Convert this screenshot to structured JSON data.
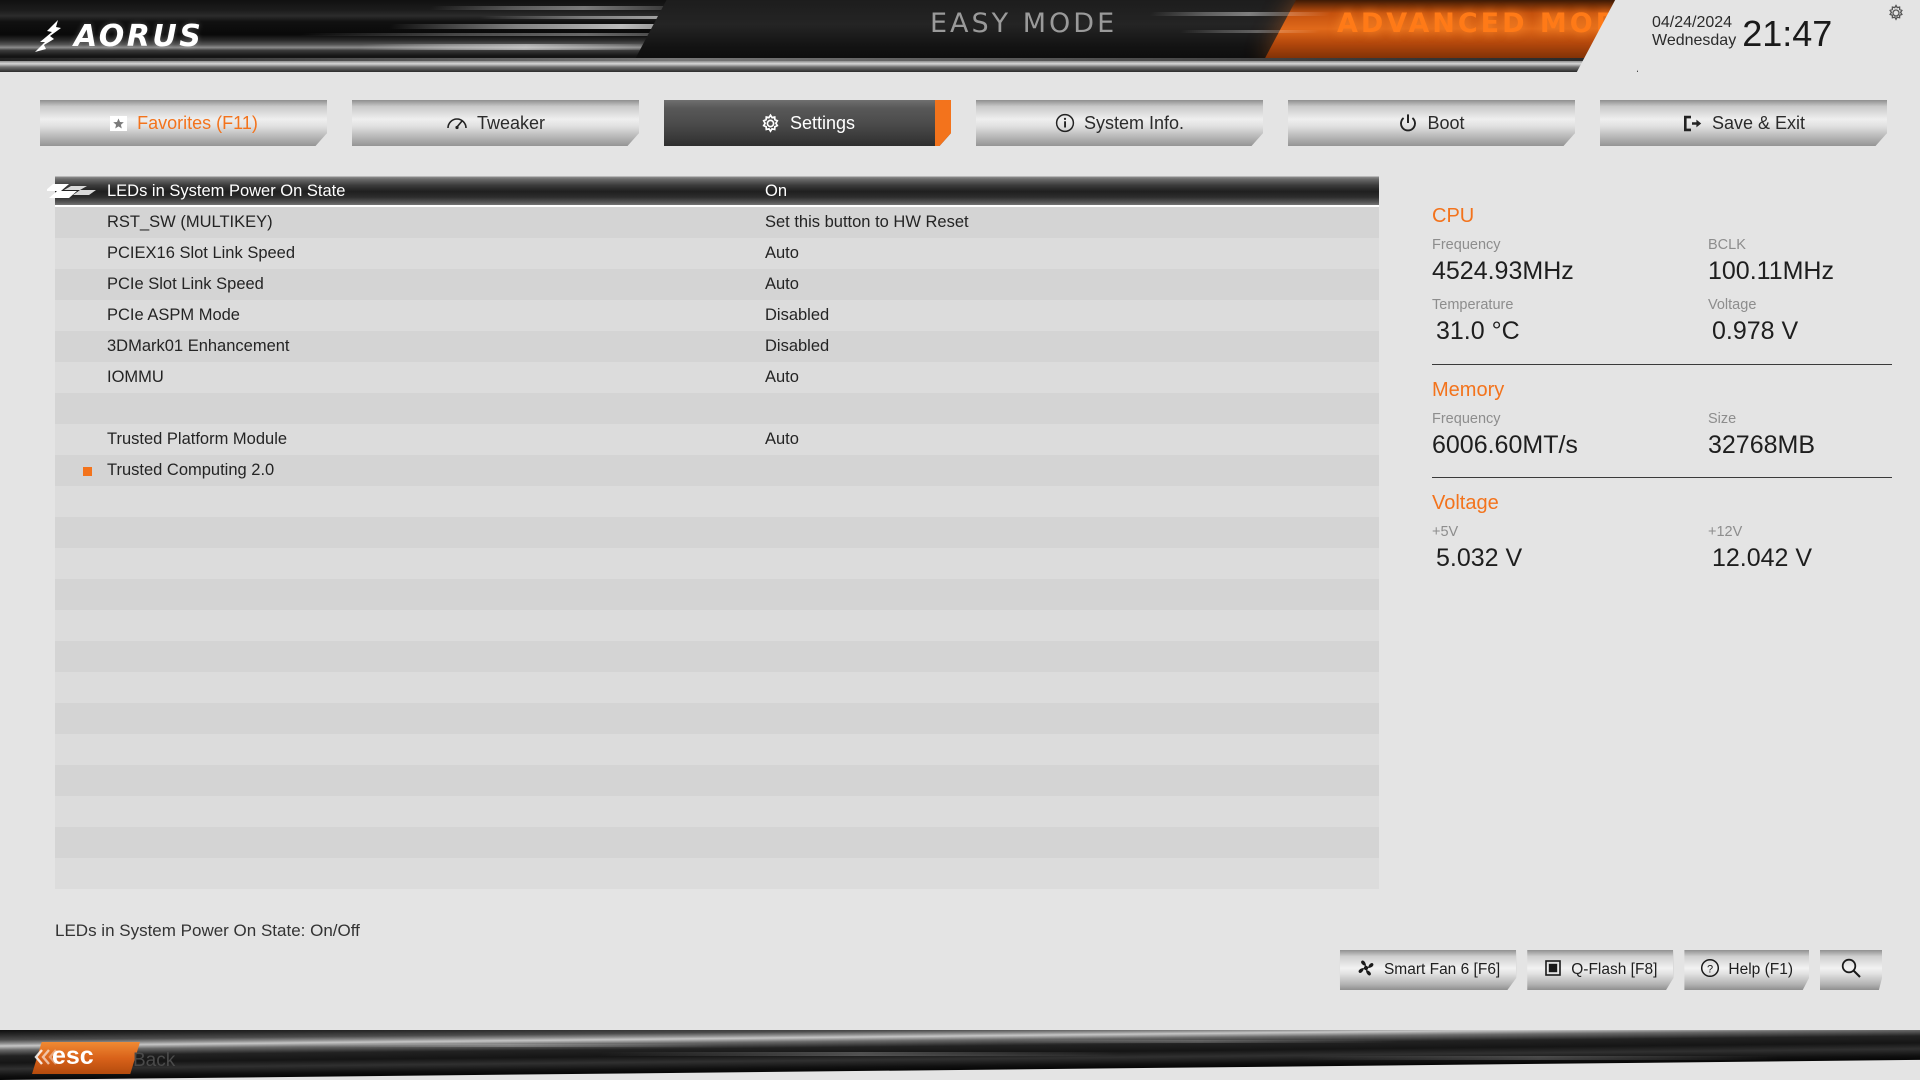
{
  "brand": {
    "logo_text": "AORUS",
    "logo_icon": "falcon-logo-icon"
  },
  "header": {
    "easy_mode": "EASY MODE",
    "advanced_mode": "ADVANCED MODE",
    "date": "04/24/2024",
    "weekday": "Wednesday",
    "time": "21:47",
    "gear_icon": "gear-icon",
    "accent_color": "#f3731c"
  },
  "tabs": [
    {
      "label": "Favorites (F11)",
      "icon": "star-icon",
      "active": false,
      "favorite": true
    },
    {
      "label": "Tweaker",
      "icon": "gauge-icon",
      "active": false,
      "favorite": false
    },
    {
      "label": "Settings",
      "icon": "gear-icon",
      "active": true,
      "favorite": false
    },
    {
      "label": "System Info.",
      "icon": "info-circle-icon",
      "active": false,
      "favorite": false
    },
    {
      "label": "Boot",
      "icon": "power-icon",
      "active": false,
      "favorite": false
    },
    {
      "label": "Save & Exit",
      "icon": "exit-door-icon",
      "active": false,
      "favorite": false
    }
  ],
  "settings_rows": [
    {
      "label": "LEDs in System Power On State",
      "value": "On",
      "selected": true,
      "bullet": false
    },
    {
      "label": "RST_SW (MULTIKEY)",
      "value": "Set this button to HW Reset",
      "selected": false,
      "bullet": false
    },
    {
      "label": "PCIEX16 Slot Link Speed",
      "value": "Auto",
      "selected": false,
      "bullet": false
    },
    {
      "label": "PCIe Slot Link Speed",
      "value": "Auto",
      "selected": false,
      "bullet": false
    },
    {
      "label": "PCIe ASPM Mode",
      "value": "Disabled",
      "selected": false,
      "bullet": false
    },
    {
      "label": "3DMark01 Enhancement",
      "value": "Disabled",
      "selected": false,
      "bullet": false
    },
    {
      "label": "IOMMU",
      "value": "Auto",
      "selected": false,
      "bullet": false
    },
    {
      "label": "",
      "value": "",
      "selected": false,
      "bullet": false
    },
    {
      "label": "Trusted Platform Module",
      "value": "Auto",
      "selected": false,
      "bullet": false
    },
    {
      "label": "Trusted Computing 2.0",
      "value": "",
      "selected": false,
      "bullet": true
    },
    {
      "label": "",
      "value": "",
      "selected": false,
      "bullet": false
    },
    {
      "label": "",
      "value": "",
      "selected": false,
      "bullet": false
    },
    {
      "label": "",
      "value": "",
      "selected": false,
      "bullet": false
    },
    {
      "label": "",
      "value": "",
      "selected": false,
      "bullet": false
    },
    {
      "label": "",
      "value": "",
      "selected": false,
      "bullet": false
    },
    {
      "label": "",
      "value": "",
      "selected": false,
      "bullet": false
    },
    {
      "label": "",
      "value": "",
      "selected": false,
      "bullet": false
    },
    {
      "label": "",
      "value": "",
      "selected": false,
      "bullet": false
    },
    {
      "label": "",
      "value": "",
      "selected": false,
      "bullet": false
    },
    {
      "label": "",
      "value": "",
      "selected": false,
      "bullet": false
    },
    {
      "label": "",
      "value": "",
      "selected": false,
      "bullet": false
    },
    {
      "label": "",
      "value": "",
      "selected": false,
      "bullet": false
    },
    {
      "label": "",
      "value": "",
      "selected": false,
      "bullet": false
    }
  ],
  "info": {
    "cpu": {
      "title": "CPU",
      "frequency_key": "Frequency",
      "frequency_val": "4524.93MHz",
      "bclk_key": "BCLK",
      "bclk_val": "100.11MHz",
      "temperature_key": "Temperature",
      "temperature_val": "31.0 °C",
      "voltage_key": "Voltage",
      "voltage_val": "0.978 V"
    },
    "memory": {
      "title": "Memory",
      "frequency_key": "Frequency",
      "frequency_val": "6006.60MT/s",
      "size_key": "Size",
      "size_val": "32768MB"
    },
    "voltage": {
      "title": "Voltage",
      "v5_key": "+5V",
      "v5_val": "5.032 V",
      "v12_key": "+12V",
      "v12_val": "12.042 V"
    }
  },
  "footer": {
    "help_text": "LEDs in System Power On State: On/Off",
    "buttons": [
      {
        "label": "Smart Fan 6 [F6]",
        "icon": "fan-icon"
      },
      {
        "label": "Q-Flash [F8]",
        "icon": "chip-icon"
      },
      {
        "label": "Help (F1)",
        "icon": "question-circle-icon"
      },
      {
        "label": "",
        "icon": "search-icon"
      }
    ],
    "esc_label": "esc",
    "back_label": "Back",
    "esc_icon": "double-chevron-left-icon"
  }
}
